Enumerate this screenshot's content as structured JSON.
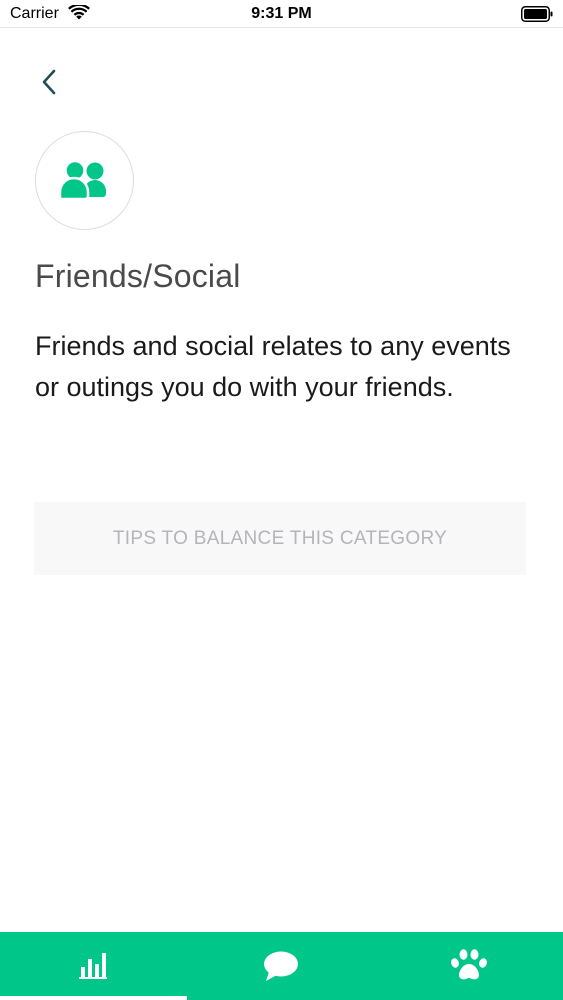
{
  "status_bar": {
    "carrier": "Carrier",
    "time": "9:31 PM",
    "wifi_icon": "wifi-icon",
    "battery_icon": "battery-full-icon"
  },
  "header": {
    "back_icon": "chevron-left-icon"
  },
  "category": {
    "icon": "people-icon",
    "title": "Friends/Social",
    "description": "Friends and social relates to any events or outings you do with your friends."
  },
  "tips_button": {
    "label": "TIPS TO BALANCE THIS CATEGORY"
  },
  "tab_bar": {
    "tabs": [
      {
        "icon": "bar-chart-icon",
        "selected": true
      },
      {
        "icon": "chat-bubble-icon",
        "selected": false
      },
      {
        "icon": "paw-icon",
        "selected": false
      }
    ]
  },
  "colors": {
    "accent": "#00c68a",
    "title": "#4a4a4a",
    "body_text": "#1a1a1a",
    "tips_bg": "#f8f8f9",
    "tips_text": "#b4b4ba",
    "back_chevron": "#1f4e5a"
  }
}
